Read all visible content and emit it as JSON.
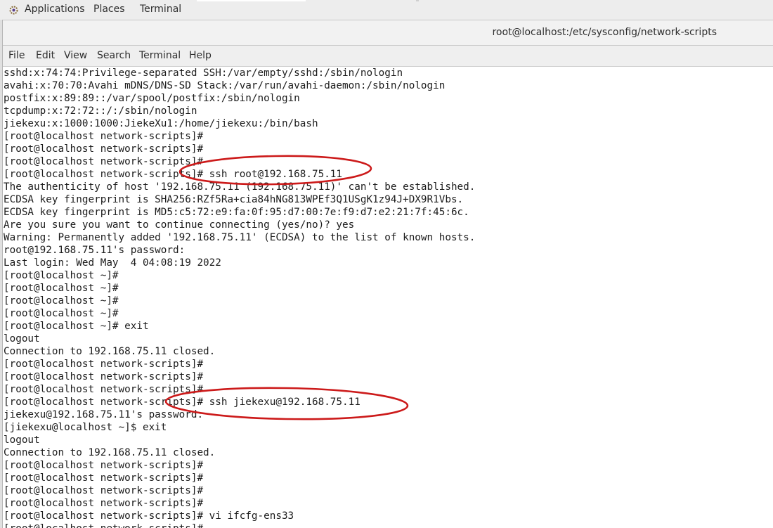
{
  "top_panel": {
    "applications": "Applications",
    "places": "Places",
    "terminal": "Terminal"
  },
  "window": {
    "title": "root@localhost:/etc/sysconfig/network-scripts"
  },
  "menu": [
    "File",
    "Edit",
    "View",
    "Search",
    "Terminal",
    "Help"
  ],
  "terminal_lines": [
    "sshd:x:74:74:Privilege-separated SSH:/var/empty/sshd:/sbin/nologin",
    "avahi:x:70:70:Avahi mDNS/DNS-SD Stack:/var/run/avahi-daemon:/sbin/nologin",
    "postfix:x:89:89::/var/spool/postfix:/sbin/nologin",
    "tcpdump:x:72:72::/:/sbin/nologin",
    "jiekexu:x:1000:1000:JiekeXu1:/home/jiekexu:/bin/bash",
    "[root@localhost network-scripts]#",
    "[root@localhost network-scripts]#",
    "[root@localhost network-scripts]#",
    "[root@localhost network-scripts]# ssh root@192.168.75.11",
    "The authenticity of host '192.168.75.11 (192.168.75.11)' can't be established.",
    "ECDSA key fingerprint is SHA256:RZf5Ra+cia84hNG813WPEf3Q1USgK1z94J+DX9R1Vbs.",
    "ECDSA key fingerprint is MD5:c5:72:e9:fa:0f:95:d7:00:7e:f9:d7:e2:21:7f:45:6c.",
    "Are you sure you want to continue connecting (yes/no)? yes",
    "Warning: Permanently added '192.168.75.11' (ECDSA) to the list of known hosts.",
    "root@192.168.75.11's password:",
    "Last login: Wed May  4 04:08:19 2022",
    "[root@localhost ~]#",
    "[root@localhost ~]#",
    "[root@localhost ~]#",
    "[root@localhost ~]#",
    "[root@localhost ~]# exit",
    "logout",
    "Connection to 192.168.75.11 closed.",
    "[root@localhost network-scripts]#",
    "[root@localhost network-scripts]#",
    "[root@localhost network-scripts]#",
    "[root@localhost network-scripts]# ssh jiekexu@192.168.75.11",
    "jiekexu@192.168.75.11's password:",
    "[jiekexu@localhost ~]$ exit",
    "logout",
    "Connection to 192.168.75.11 closed.",
    "[root@localhost network-scripts]#",
    "[root@localhost network-scripts]#",
    "[root@localhost network-scripts]#",
    "[root@localhost network-scripts]#",
    "[root@localhost network-scripts]# vi ifcfg-ens33",
    "[root@localhost network-scripts]#"
  ],
  "colors": {
    "annotation": "#cc1a1a",
    "panel_bg": "#ededed",
    "terminal_bg": "#ffffff",
    "terminal_fg": "#1c1c1c"
  }
}
